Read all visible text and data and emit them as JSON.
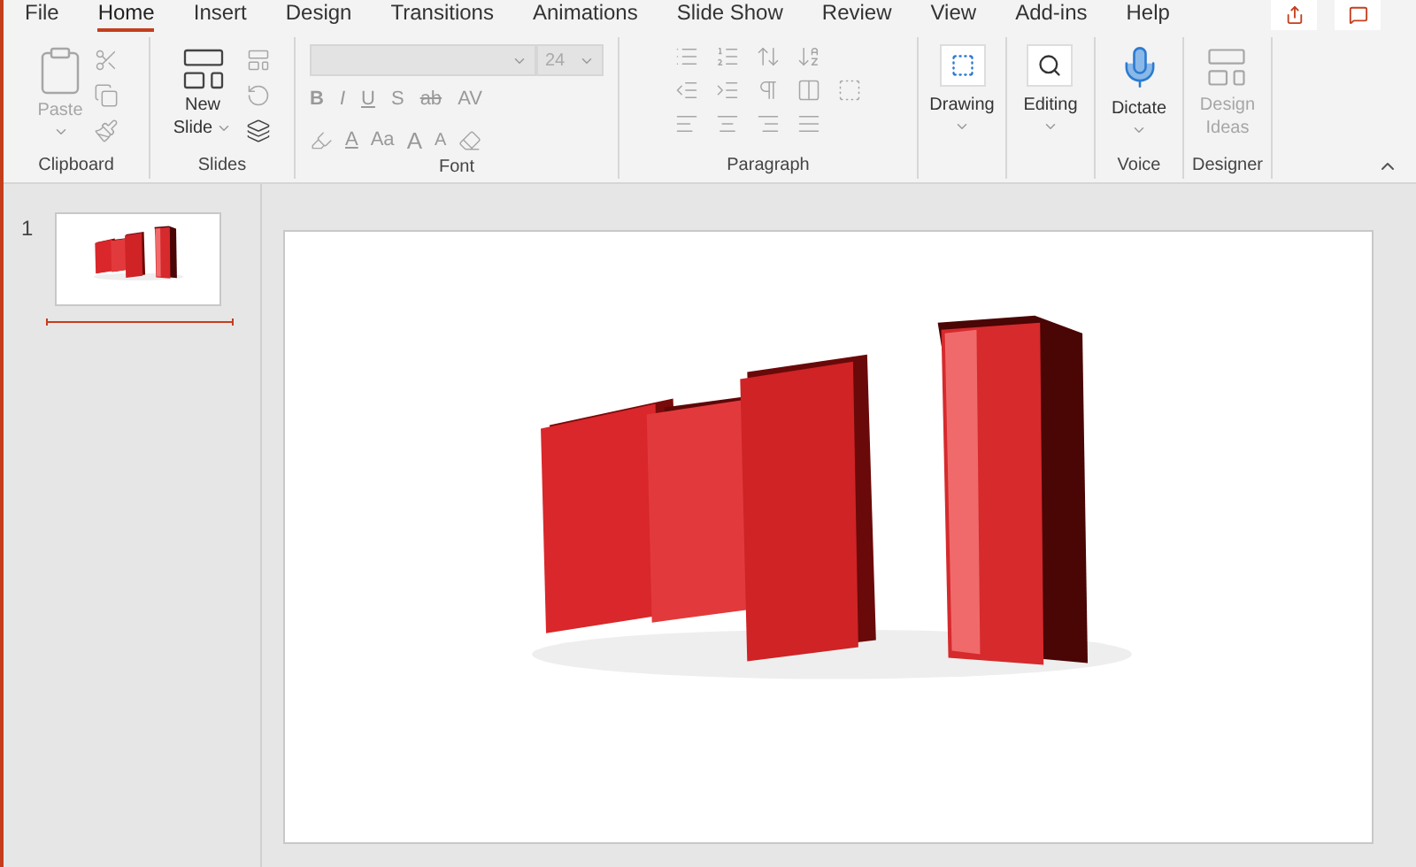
{
  "tabs": [
    {
      "label": "File",
      "selected": false
    },
    {
      "label": "Home",
      "selected": true
    },
    {
      "label": "Insert",
      "selected": false
    },
    {
      "label": "Design",
      "selected": false
    },
    {
      "label": "Transitions",
      "selected": false
    },
    {
      "label": "Animations",
      "selected": false
    },
    {
      "label": "Slide Show",
      "selected": false
    },
    {
      "label": "Review",
      "selected": false
    },
    {
      "label": "View",
      "selected": false
    },
    {
      "label": "Add-ins",
      "selected": false
    },
    {
      "label": "Help",
      "selected": false
    }
  ],
  "ribbon": {
    "clipboard": {
      "label": "Clipboard",
      "paste": {
        "label": "Paste",
        "disabled": true
      }
    },
    "slides": {
      "label": "Slides",
      "new_slide": {
        "line1": "New",
        "line2": "Slide"
      }
    },
    "font": {
      "label": "Font",
      "size": "24",
      "format_buttons": [
        "B",
        "I",
        "U",
        "S",
        "ab",
        "AV"
      ],
      "case_button": "Aa",
      "grow_button": "A",
      "shrink_button": "A",
      "font_color": "A"
    },
    "paragraph": {
      "label": "Paragraph"
    },
    "drawing": {
      "label": "Drawing",
      "disabled": false
    },
    "editing": {
      "label": "Editing",
      "disabled": false
    },
    "voice": {
      "label": "Voice",
      "dictate": {
        "label": "Dictate",
        "disabled": false
      }
    },
    "designer": {
      "label": "Designer",
      "design_ideas": {
        "line1": "Design",
        "line2": "Ideas",
        "disabled": true
      }
    }
  },
  "slides": [
    {
      "number": "1"
    }
  ]
}
